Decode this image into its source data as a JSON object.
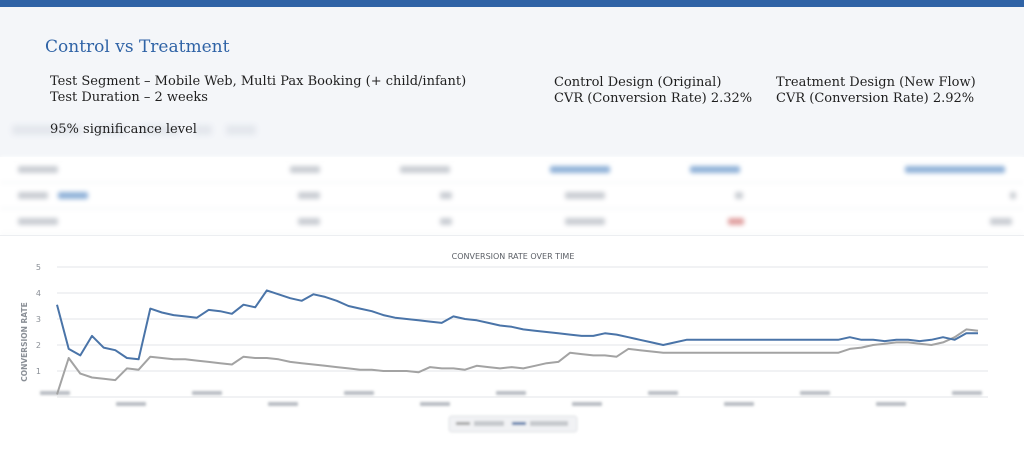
{
  "header": {
    "title": "Control vs Treatment",
    "segment": "Test Segment – Mobile Web, Multi Pax Booking (+ child/infant)",
    "duration": "Test Duration – 2 weeks",
    "significance": "95% significance level"
  },
  "control": {
    "label": "Control Design (Original)",
    "cvr": "CVR (Conversion Rate) 2.32%"
  },
  "treatment": {
    "label": "Treatment Design (New Flow)",
    "cvr": "CVR (Conversion Rate) 2.92%"
  },
  "colors": {
    "accent": "#2f63a6",
    "control_line": "#4a74a8",
    "treatment_line": "#a3a3a3"
  },
  "chart_data": {
    "type": "line",
    "title": "CONVERSION RATE OVER TIME",
    "ylabel": "CONVERSION RATE",
    "xlabel": "",
    "ylim": [
      0,
      5
    ],
    "yticks": [
      "1",
      "2",
      "3",
      "4",
      "5"
    ],
    "grid": true,
    "x_points": 80,
    "series": [
      {
        "color": "#4a74a8",
        "values": [
          3.55,
          1.85,
          1.6,
          2.35,
          1.9,
          1.8,
          1.5,
          1.45,
          3.4,
          3.25,
          3.15,
          3.1,
          3.05,
          3.35,
          3.3,
          3.2,
          3.55,
          3.45,
          4.1,
          3.95,
          3.8,
          3.7,
          3.95,
          3.85,
          3.7,
          3.5,
          3.4,
          3.3,
          3.15,
          3.05,
          3.0,
          2.95,
          2.9,
          2.85,
          3.1,
          3.0,
          2.95,
          2.85,
          2.75,
          2.7,
          2.6,
          2.55,
          2.5,
          2.45,
          2.4,
          2.35,
          2.35,
          2.45,
          2.4,
          2.3,
          2.2,
          2.1,
          2.0,
          2.1,
          2.2,
          2.2,
          2.2,
          2.2,
          2.2,
          2.2,
          2.2,
          2.2,
          2.2,
          2.2,
          2.2,
          2.2,
          2.2,
          2.2,
          2.3,
          2.2,
          2.2,
          2.15,
          2.2,
          2.2,
          2.15,
          2.2,
          2.3,
          2.2,
          2.45,
          2.45
        ]
      },
      {
        "color": "#a3a3a3",
        "values": [
          0.1,
          1.5,
          0.9,
          0.75,
          0.7,
          0.65,
          1.1,
          1.05,
          1.55,
          1.5,
          1.45,
          1.45,
          1.4,
          1.35,
          1.3,
          1.25,
          1.55,
          1.5,
          1.5,
          1.45,
          1.35,
          1.3,
          1.25,
          1.2,
          1.15,
          1.1,
          1.05,
          1.05,
          1.0,
          1.0,
          1.0,
          0.95,
          1.15,
          1.1,
          1.1,
          1.05,
          1.2,
          1.15,
          1.1,
          1.15,
          1.1,
          1.2,
          1.3,
          1.35,
          1.7,
          1.65,
          1.6,
          1.6,
          1.55,
          1.85,
          1.8,
          1.75,
          1.7,
          1.7,
          1.7,
          1.7,
          1.7,
          1.7,
          1.7,
          1.7,
          1.7,
          1.7,
          1.7,
          1.7,
          1.7,
          1.7,
          1.7,
          1.7,
          1.85,
          1.9,
          2.0,
          2.05,
          2.1,
          2.1,
          2.05,
          2.0,
          2.1,
          2.3,
          2.6,
          2.55
        ]
      }
    ]
  }
}
